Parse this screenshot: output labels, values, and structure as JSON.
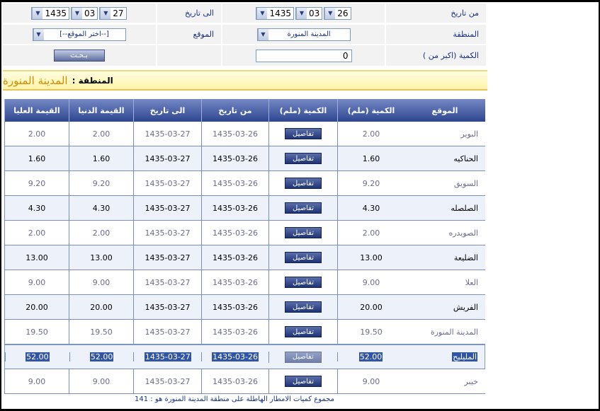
{
  "filters": {
    "from_label": "من تاريخ",
    "to_label": "الى تاريخ",
    "region_label": "المنطقة",
    "site_label": "الموقع",
    "qty_label": "الكمية (اكبر من )",
    "from_date": {
      "day": "26",
      "month": "03",
      "year": "1435"
    },
    "to_date": {
      "day": "27",
      "month": "03",
      "year": "1435"
    },
    "region_value": "المدينة المنورة",
    "site_value": "[--اختر الموقع--]",
    "qty_value": "0",
    "search_label": "بـحـث"
  },
  "banner": {
    "label": "المنطقة :",
    "value": "المدينة المنورة"
  },
  "table": {
    "headers": {
      "location": "الموقع",
      "qty1": "الكمية (ملم)",
      "qty2": "الكمية (ملم)",
      "from": "من تاريخ",
      "to": "الى تاريخ",
      "min": "القيمة الدنيا",
      "max": "القيمة العليا"
    },
    "details_label": "تفاصيل",
    "rows": [
      {
        "location": "البوير",
        "qty": "2.00",
        "from": "1435-03-26",
        "to": "1435-03-27",
        "min": "2.00",
        "max": "2.00"
      },
      {
        "location": "الحناكيه",
        "qty": "1.60",
        "from": "1435-03-26",
        "to": "1435-03-27",
        "min": "1.60",
        "max": "1.60"
      },
      {
        "location": "السويق",
        "qty": "9.20",
        "from": "1435-03-26",
        "to": "1435-03-27",
        "min": "9.20",
        "max": "9.20"
      },
      {
        "location": "الصلصله",
        "qty": "4.30",
        "from": "1435-03-26",
        "to": "1435-03-27",
        "min": "4.30",
        "max": "4.30"
      },
      {
        "location": "الصويدره",
        "qty": "2.00",
        "from": "1435-03-26",
        "to": "1435-03-27",
        "min": "2.00",
        "max": "2.00"
      },
      {
        "location": "الضليعة",
        "qty": "13.00",
        "from": "1435-03-26",
        "to": "1435-03-27",
        "min": "13.00",
        "max": "13.00"
      },
      {
        "location": "العلا",
        "qty": "9.00",
        "from": "1435-03-26",
        "to": "1435-03-27",
        "min": "9.00",
        "max": "9.00"
      },
      {
        "location": "الفريش",
        "qty": "20.00",
        "from": "1435-03-26",
        "to": "1435-03-27",
        "min": "20.00",
        "max": "20.00"
      },
      {
        "location": "المدينة المنورة",
        "qty": "19.50",
        "from": "1435-03-26",
        "to": "1435-03-27",
        "min": "19.50",
        "max": "19.50"
      },
      {
        "location": "المليليح",
        "qty": "52.00",
        "from": "1435-03-26",
        "to": "1435-03-27",
        "min": "52.00",
        "max": "52.00"
      },
      {
        "location": "خيبر",
        "qty": "9.00",
        "from": "1435-03-26",
        "to": "1435-03-27",
        "min": "9.00",
        "max": "9.00"
      }
    ]
  },
  "footer": "مجموع كميات الامطار الهاطلة على منطقة المدينة المنورة هو : 141"
}
